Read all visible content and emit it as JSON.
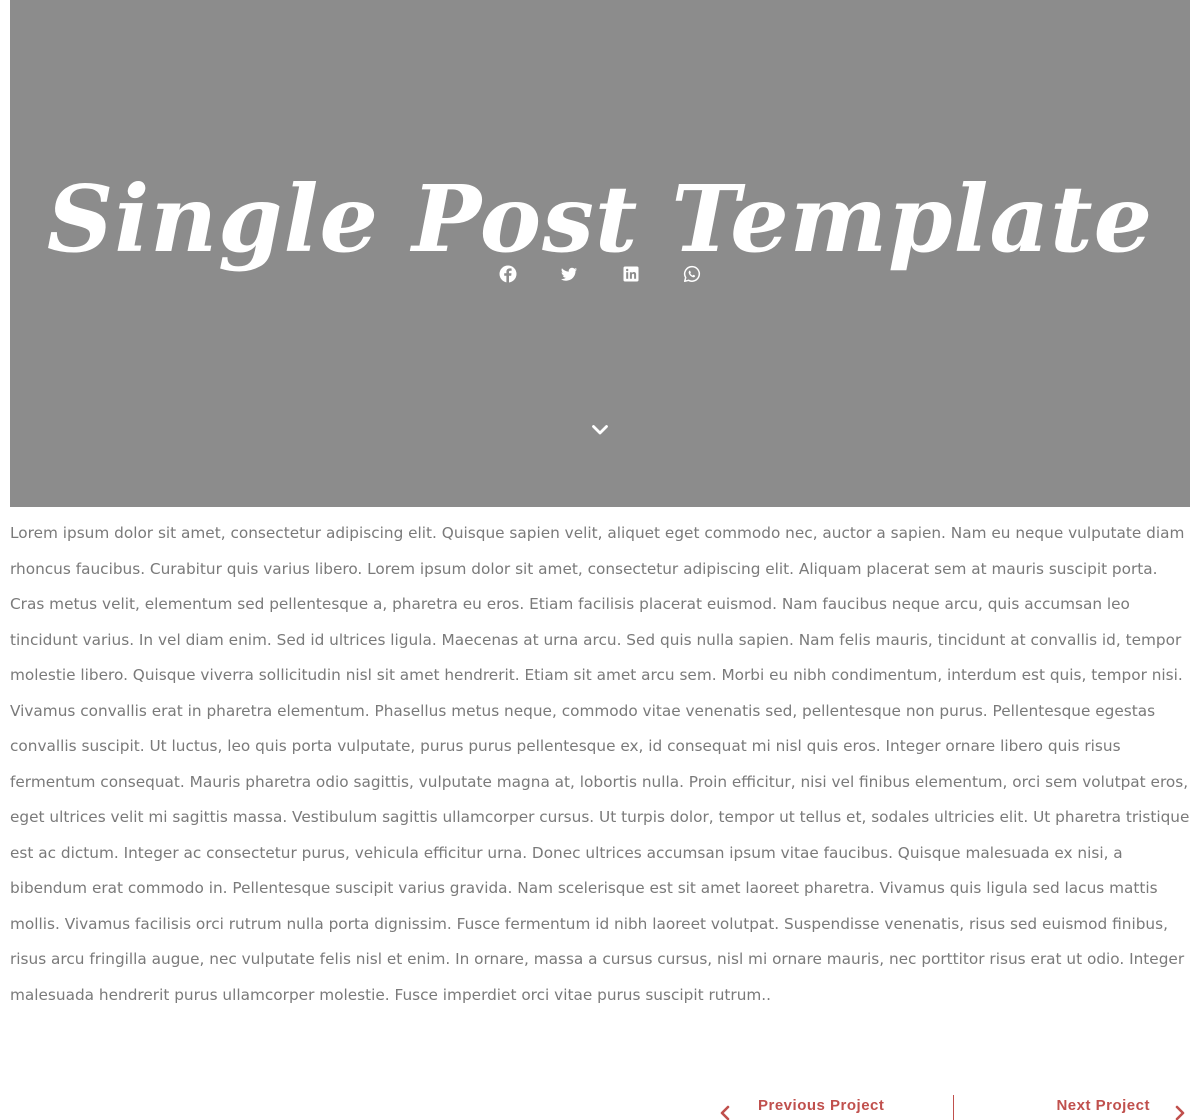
{
  "hero": {
    "title": "Single Post Template",
    "background": "#8c8c8c",
    "share_buttons": [
      {
        "network": "facebook",
        "icon": "facebook-icon"
      },
      {
        "network": "twitter",
        "icon": "twitter-icon"
      },
      {
        "network": "linkedin",
        "icon": "linkedin-icon"
      },
      {
        "network": "whatsapp",
        "icon": "whatsapp-icon"
      }
    ],
    "scroll_icon": "chevron-down-icon"
  },
  "post": {
    "body": "Lorem ipsum dolor sit amet, consectetur adipiscing elit. Quisque sapien velit, aliquet eget commodo nec, auctor a sapien. Nam eu neque vulputate diam rhoncus faucibus. Curabitur quis varius libero. Lorem ipsum dolor sit amet, consectetur adipiscing elit. Aliquam placerat sem at mauris suscipit porta. Cras metus velit, elementum sed pellentesque a, pharetra eu eros. Etiam facilisis placerat euismod. Nam faucibus neque arcu, quis accumsan leo tincidunt varius. In vel diam enim. Sed id ultrices ligula. Maecenas at urna arcu. Sed quis nulla sapien. Nam felis mauris, tincidunt at convallis id, tempor molestie libero. Quisque viverra sollicitudin nisl sit amet hendrerit. Etiam sit amet arcu sem. Morbi eu nibh condimentum, interdum est quis, tempor nisi. Vivamus convallis erat in pharetra elementum. Phasellus metus neque, commodo vitae venenatis sed, pellentesque non purus. Pellentesque egestas convallis suscipit. Ut luctus, leo quis porta vulputate, purus purus pellentesque ex, id consequat mi nisl quis eros. Integer ornare libero quis risus fermentum consequat. Mauris pharetra odio sagittis, vulputate magna at, lobortis nulla. Proin efficitur, nisi vel finibus elementum, orci sem volutpat eros, eget ultrices velit mi sagittis massa. Vestibulum sagittis ullamcorper cursus. Ut turpis dolor, tempor ut tellus et, sodales ultricies elit. Ut pharetra tristique est ac dictum. Integer ac consectetur purus, vehicula efficitur urna. Donec ultrices accumsan ipsum vitae faucibus. Quisque malesuada ex nisi, a bibendum erat commodo in. Pellentesque suscipit varius gravida. Nam scelerisque est sit amet laoreet pharetra. Vivamus quis ligula sed lacus mattis mollis. Vivamus facilisis orci rutrum nulla porta dignissim. Fusce fermentum id nibh laoreet volutpat. Suspendisse venenatis, risus sed euismod finibus, risus arcu fringilla augue, nec vulputate felis nisl et enim. In ornare, massa a cursus cursus, nisl mi ornare mauris, nec porttitor risus erat ut odio. Integer malesuada hendrerit purus ullamcorper molestie. Fusce imperdiet orci vitae purus suscipit rutrum.."
  },
  "post_nav": {
    "previous_label": "Previous Project",
    "next_label": "Next Project",
    "previous_icon": "chevron-left-icon",
    "next_icon": "chevron-right-icon",
    "accent_color": "#c0504d"
  }
}
